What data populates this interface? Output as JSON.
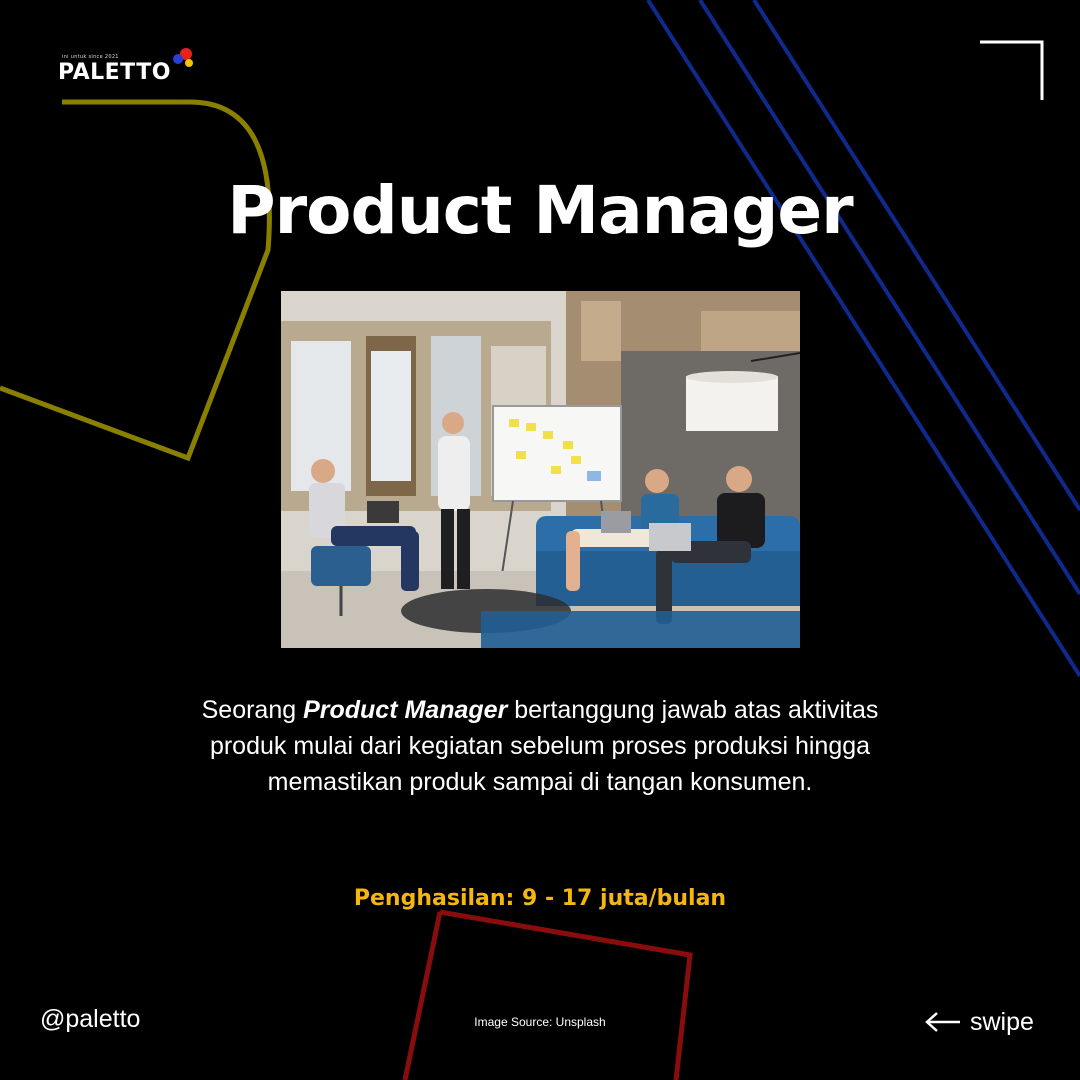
{
  "brand": {
    "name": "PALETTO",
    "tagline": "ini untuk since 2021",
    "dot_colors": [
      "#e8211c",
      "#2a3fd6",
      "#f5c400"
    ]
  },
  "post": {
    "title": "Product Manager",
    "description": {
      "lead": "Seorang ",
      "emphasis": "Product Manager",
      "rest": " bertanggung jawab atas aktivitas produk mulai dari kegiatan sebelum proses produksi hingga memastikan produk sampai di tangan konsumen."
    },
    "salary": "Penghasilan: 9 - 17 juta/bulan"
  },
  "footer": {
    "handle": "@paletto",
    "image_source": "Image Source: Unsplash",
    "swipe_label": "swipe"
  },
  "icons": {
    "swipe": "arrow-left-icon",
    "corner": "corner-bracket-icon"
  },
  "colors": {
    "background": "#000000",
    "text": "#ffffff",
    "salary": "#f5b70f",
    "olive_outline": "#8a8000",
    "blue_lines": "#0f2a8c",
    "red_outline": "#8a0d0d"
  }
}
